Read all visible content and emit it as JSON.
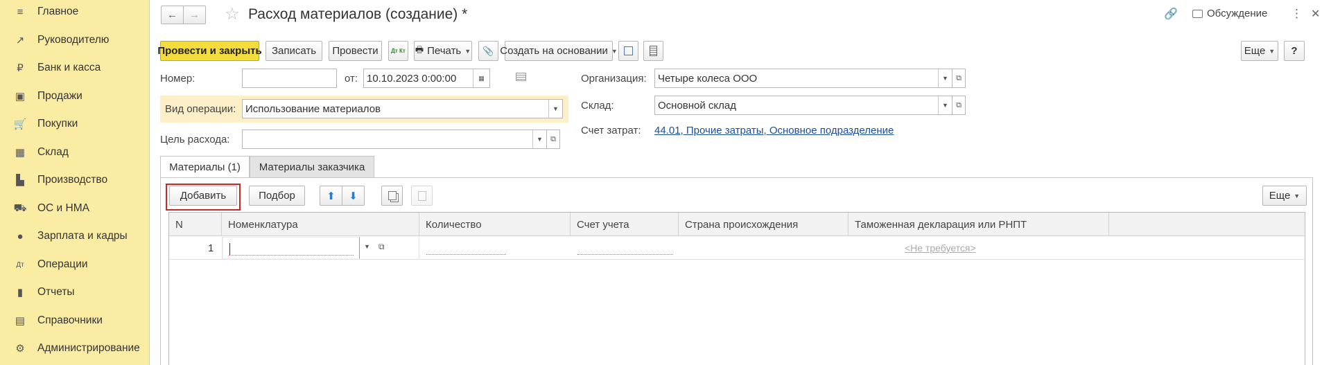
{
  "sidebar": {
    "items": [
      {
        "label": "Главное",
        "icon": "≡"
      },
      {
        "label": "Руководителю",
        "icon": "↗"
      },
      {
        "label": "Банк и касса",
        "icon": "₽"
      },
      {
        "label": "Продажи",
        "icon": "▣"
      },
      {
        "label": "Покупки",
        "icon": "🛒"
      },
      {
        "label": "Склад",
        "icon": "▦"
      },
      {
        "label": "Производство",
        "icon": "▙"
      },
      {
        "label": "ОС и НМА",
        "icon": "⛟"
      },
      {
        "label": "Зарплата и кадры",
        "icon": "●"
      },
      {
        "label": "Операции",
        "icon": "Дт"
      },
      {
        "label": "Отчеты",
        "icon": "▮"
      },
      {
        "label": "Справочники",
        "icon": "▤"
      },
      {
        "label": "Администрирование",
        "icon": "⚙"
      }
    ]
  },
  "header": {
    "title": "Расход материалов (создание) *",
    "discussion": "Обсуждение",
    "back": "←",
    "forward": "→",
    "star": "☆",
    "link_icon": "🔗",
    "more_icon": "⋮",
    "close_icon": "✕"
  },
  "toolbar": {
    "post_close": "Провести и закрыть",
    "save": "Записать",
    "post": "Провести",
    "dtkt": "Дт Кт",
    "print": "Печать",
    "create_based": "Создать на основании",
    "more": "Еще",
    "help": "?"
  },
  "form": {
    "number_label": "Номер:",
    "number_value": "",
    "date_label": "от:",
    "date_value": "10.10.2023  0:00:00",
    "operation_label": "Вид операции:",
    "operation_value": "Использование материалов",
    "purpose_label": "Цель расхода:",
    "purpose_value": "",
    "org_label": "Организация:",
    "org_value": "Четыре колеса ООО",
    "warehouse_label": "Склад:",
    "warehouse_value": "Основной склад",
    "cost_account_label": "Счет затрат:",
    "cost_account_value": "44.01, Прочие затраты, Основное подразделение"
  },
  "tabs": [
    {
      "label": "Материалы (1)",
      "active": true
    },
    {
      "label": "Материалы заказчика",
      "active": false
    }
  ],
  "table_toolbar": {
    "add": "Добавить",
    "select": "Подбор",
    "more": "Еще"
  },
  "table": {
    "columns": [
      "N",
      "Номенклатура",
      "Количество",
      "Счет учета",
      "Страна происхождения",
      "Таможенная декларация или РНПТ"
    ],
    "rows": [
      {
        "n": "1",
        "nomenclature": "",
        "quantity": "",
        "account": "",
        "country": "",
        "customs": "<Не требуется>"
      }
    ]
  },
  "colors": {
    "sidebar_bg": "#fbeca4",
    "primary_button": "#f5dc3d",
    "highlight_bg": "#fdefc8",
    "add_outline": "#c62828",
    "link": "#1a4fa0"
  }
}
